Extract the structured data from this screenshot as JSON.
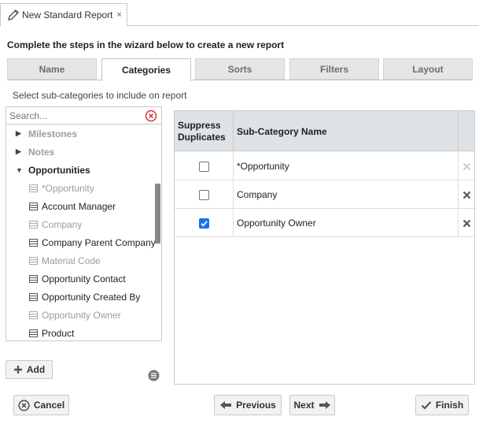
{
  "doc_tab": {
    "title": "New Standard Report",
    "close": "×"
  },
  "instruction": "Complete the steps in the wizard below to create a new report",
  "wizard_tabs": [
    {
      "label": "Name"
    },
    {
      "label": "Categories",
      "active": true
    },
    {
      "label": "Sorts"
    },
    {
      "label": "Filters"
    },
    {
      "label": "Layout"
    }
  ],
  "subtitle": "Select sub-categories to include on report",
  "search": {
    "placeholder": "Search...",
    "value": ""
  },
  "tree": {
    "categories": [
      {
        "label": "Milestones",
        "expanded": false,
        "disabled": true
      },
      {
        "label": "Notes",
        "expanded": false,
        "disabled": true
      },
      {
        "label": "Opportunities",
        "expanded": true,
        "disabled": false
      }
    ],
    "items": [
      {
        "label": "*Opportunity",
        "disabled": true
      },
      {
        "label": "Account Manager",
        "disabled": false
      },
      {
        "label": "Company",
        "disabled": true
      },
      {
        "label": "Company Parent Company",
        "disabled": false
      },
      {
        "label": "Material Code",
        "disabled": true
      },
      {
        "label": "Opportunity Contact",
        "disabled": false
      },
      {
        "label": "Opportunity Created By",
        "disabled": false
      },
      {
        "label": "Opportunity Owner",
        "disabled": true
      },
      {
        "label": "Product",
        "disabled": false
      }
    ]
  },
  "add_button": "Add",
  "grid": {
    "headers": {
      "suppress_line1": "Suppress",
      "suppress_line2": "Duplicates",
      "name": "Sub-Category Name"
    },
    "rows": [
      {
        "name": "*Opportunity",
        "suppress": false,
        "removable": false
      },
      {
        "name": "Company",
        "suppress": false,
        "removable": true
      },
      {
        "name": "Opportunity Owner",
        "suppress": true,
        "removable": true
      }
    ]
  },
  "buttons": {
    "cancel": "Cancel",
    "previous": "Previous",
    "next": "Next",
    "finish": "Finish"
  },
  "colors": {
    "accent": "#1a73e8",
    "header_bg": "#dde3e6",
    "clear_red": "#d9303a"
  }
}
